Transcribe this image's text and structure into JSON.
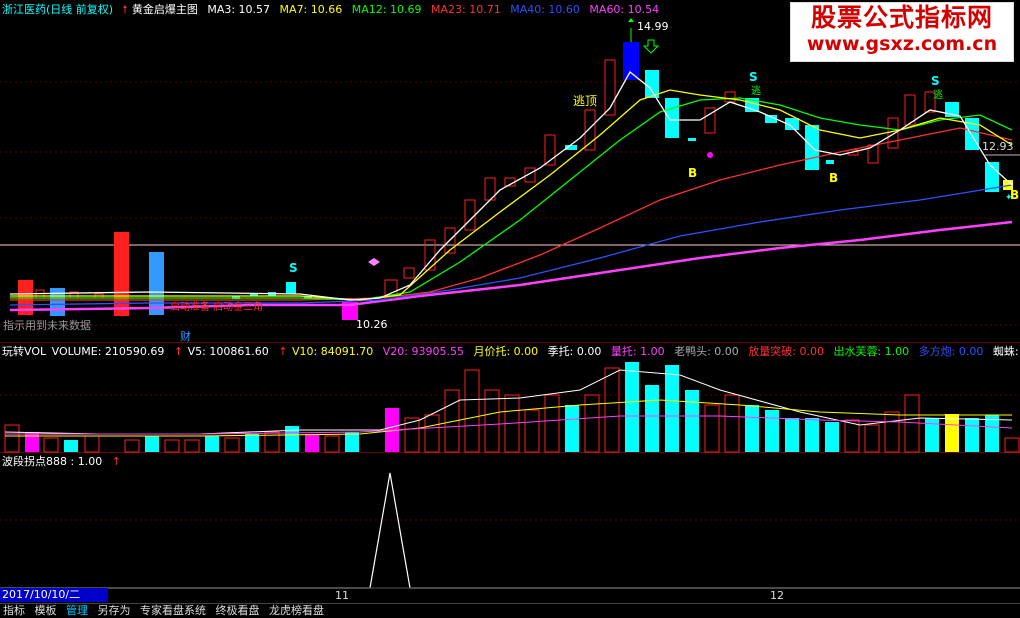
{
  "main_header": {
    "stock": "浙江医药(日线 前复权)",
    "formula": "黄金启爆主图",
    "ma3": "MA3: 10.57",
    "ma7": "MA7: 10.66",
    "ma12": "MA12: 10.69",
    "ma23": "MA23: 10.71",
    "ma40": "MA40: 10.60",
    "ma60": "MA60: 10.54"
  },
  "colors": {
    "ma3": "#ffffff",
    "ma7": "#ffff00",
    "ma12": "#00ff00",
    "ma23": "#ff3030",
    "ma40": "#3050ff",
    "ma60": "#ff40ff",
    "up": "#ff2020",
    "down": "#00ffff",
    "volume_white": "#ffffff"
  },
  "annotations": {
    "high_price": "14.99",
    "low_price": "10.26",
    "escape_top": "逃顶",
    "sell_s": "S",
    "buy_b": "B",
    "escape_small": "逃",
    "price_right": "12.93",
    "cai": "财",
    "future_hint": "指示用到未来数据",
    "startup_hint": "启动准备 启动金三角"
  },
  "volume_header": {
    "name": "玩转VOL",
    "volume": "VOLUME: 210590.69",
    "v5": "V5: 100861.60",
    "v10": "V10: 84091.70",
    "v20": "V20: 93905.55",
    "yuejia": "月价托: 0.00",
    "jishou": "季托: 0.00",
    "liangtuo": "量托: 1.00",
    "laoyatou": "老鸭头: 0.00",
    "fangliang": "放量突破: 0.00",
    "chushui": "出水芙蓉: 1.00",
    "duofang": "多方炮: 0.00",
    "zhizhu": "蜘蛛: "
  },
  "wave_header": {
    "name": "波段拐点888",
    "value": ": 1.00"
  },
  "axis": {
    "date": "2017/10/10/二",
    "month_11": "11",
    "month_12": "12"
  },
  "watermark": {
    "title": "股票公式指标网",
    "url": "www.gsxz.com.cn"
  },
  "bottom_tabs": [
    "指标",
    "模板",
    "管理",
    "另存为",
    "专家看盘系统",
    "终极看盘",
    "龙虎榜看盘"
  ]
}
